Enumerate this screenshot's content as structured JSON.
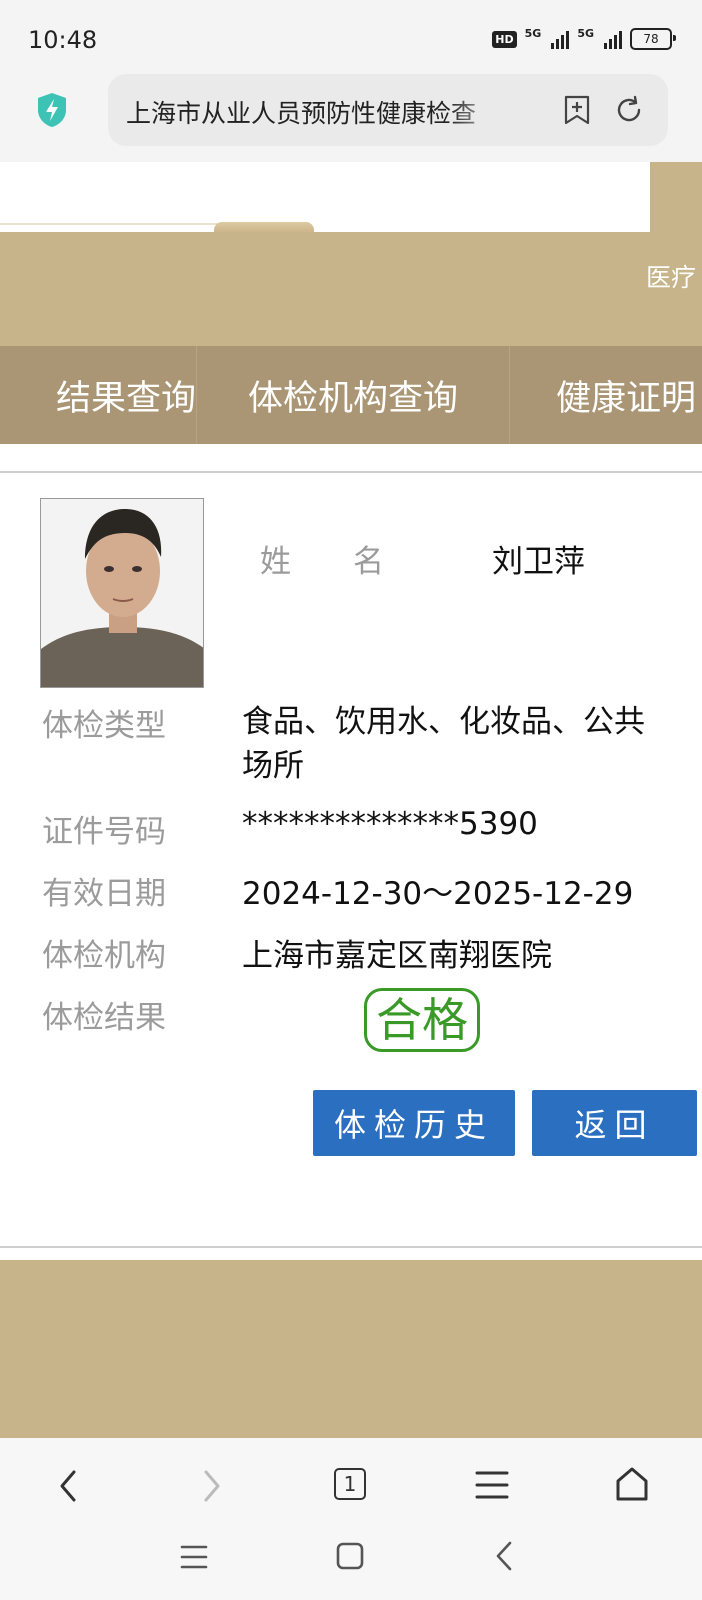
{
  "status_bar": {
    "time": "10:48",
    "network_badge": "HD",
    "network_1": "5G",
    "network_2": "5G",
    "battery": "78"
  },
  "browser": {
    "url_title": "上海市从业人员预防性健康检查",
    "security_icon": "shield-bolt-icon",
    "bookmark_icon": "bookmark-add-icon",
    "refresh_icon": "refresh-icon"
  },
  "banner": {
    "right_text": "医疗"
  },
  "nav_tabs": [
    {
      "label": "结果查询"
    },
    {
      "label": "体检机构查询"
    },
    {
      "label": "健康证明"
    }
  ],
  "record": {
    "name_label": "姓名",
    "name": "刘卫萍",
    "fields": [
      {
        "label": "体检类型",
        "value": "食品、饮用水、化妆品、公共场所"
      },
      {
        "label": "证件号码",
        "value": "**************5390"
      },
      {
        "label": "有效日期",
        "value": "2024-12-30～2025-12-29"
      },
      {
        "label": "体检机构",
        "value": "上海市嘉定区南翔医院"
      },
      {
        "label": "体检结果",
        "value": "合格"
      }
    ],
    "result_color": "#3a9a27"
  },
  "buttons": {
    "history": "体检历史",
    "back": "返回",
    "color": "#2a6fc0"
  },
  "browser_toolbar": {
    "tab_count": "1"
  },
  "theme": {
    "banner_color": "#c8b48a",
    "nav_color": "#aa9674"
  }
}
